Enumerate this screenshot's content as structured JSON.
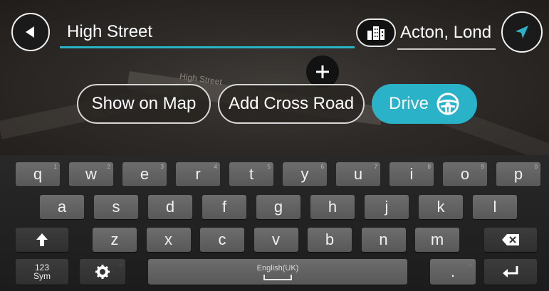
{
  "search": {
    "street_value": "High Street",
    "city_value": "Acton, Lond"
  },
  "map": {
    "road_label": "High Street"
  },
  "actions": {
    "show_on_map_label": "Show on Map",
    "add_cross_road_label": "Add Cross Road",
    "drive_label": "Drive"
  },
  "colors": {
    "accent": "#2ab2c8",
    "keyboard_key": "#606060",
    "keyboard_background": "#222222"
  },
  "icons": {
    "back": "back-arrow-icon",
    "city": "city-buildings-icon",
    "location": "location-arrow-icon",
    "pin": "plus-icon",
    "drive": "steering-wheel-icon",
    "shift": "shift-arrow-icon",
    "backspace": "backspace-icon",
    "settings": "gear-icon",
    "enter": "enter-icon"
  },
  "keyboard": {
    "row1": [
      {
        "label": "q",
        "hint": "1"
      },
      {
        "label": "w",
        "hint": "2"
      },
      {
        "label": "e",
        "hint": "3"
      },
      {
        "label": "r",
        "hint": "4"
      },
      {
        "label": "t",
        "hint": "5"
      },
      {
        "label": "y",
        "hint": "6"
      },
      {
        "label": "u",
        "hint": "7"
      },
      {
        "label": "i",
        "hint": "8"
      },
      {
        "label": "o",
        "hint": "9"
      },
      {
        "label": "p",
        "hint": "0"
      }
    ],
    "row2": [
      "a",
      "s",
      "d",
      "f",
      "g",
      "h",
      "j",
      "k",
      "l"
    ],
    "row3": [
      "z",
      "x",
      "c",
      "v",
      "b",
      "n",
      "m"
    ],
    "sym_label_top": "123",
    "sym_label_bottom": "Sym",
    "settings_hint": "..",
    "space_label": "English(UK)",
    "period_label": ".",
    "period_hint": "..."
  }
}
